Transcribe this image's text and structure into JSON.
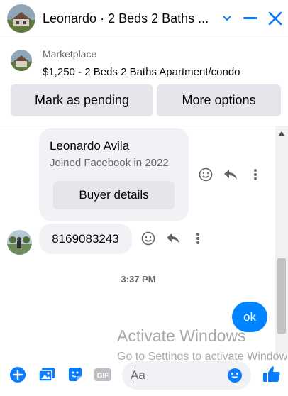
{
  "header": {
    "title": "Leonardo · 2 Beds 2 Baths ...",
    "avatar_icon": "house-photo-avatar",
    "dropdown_icon": "chevron-down-icon",
    "minimize_icon": "minimize-icon",
    "close_icon": "close-icon"
  },
  "listing": {
    "kicker": "Marketplace",
    "title": "$1,250 - 2 Beds 2 Baths Apartment/condo",
    "mark_pending_label": "Mark as pending",
    "more_options_label": "More options"
  },
  "messages": {
    "profile_card": {
      "name": "Leonardo Avila",
      "subtitle": "Joined Facebook in 2022",
      "button_label": "Buyer details"
    },
    "phone_message": "8169083243",
    "timestamp": "3:37 PM",
    "outgoing_message": "ok"
  },
  "watermark": {
    "title": "Activate Windows",
    "subtitle": "Go to Settings to activate Windows."
  },
  "composer": {
    "placeholder": "Aa",
    "gif_label": "GIF"
  },
  "colors": {
    "accent": "#0084ff",
    "messenger_blue": "#0a7cff",
    "bubble_bg": "#f0f2f5",
    "button_bg": "#e4e6eb",
    "secondary_text": "#65676b"
  }
}
